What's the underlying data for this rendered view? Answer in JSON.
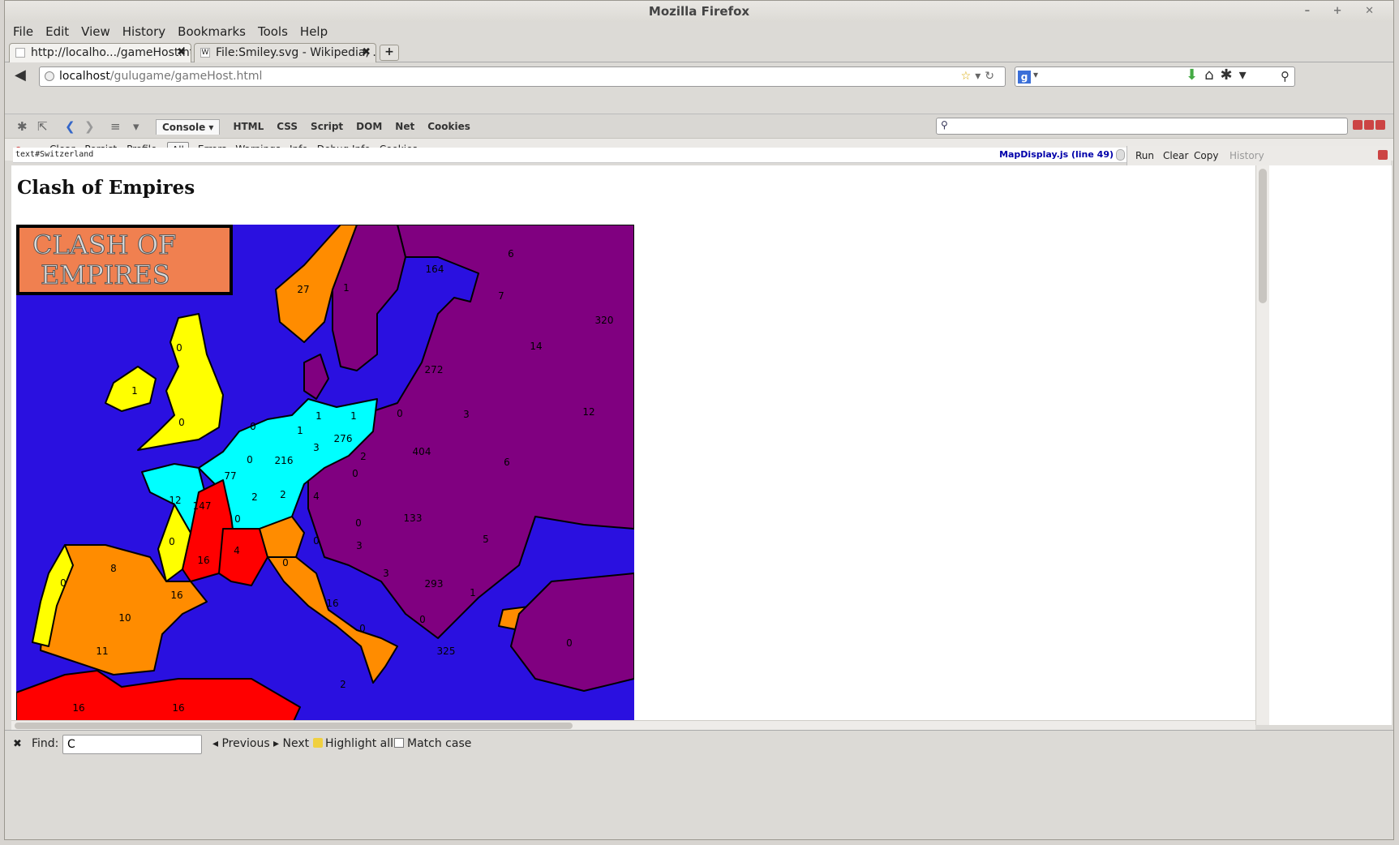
{
  "window": {
    "title": "Mozilla Firefox",
    "controls": "– + ✕"
  },
  "menu": [
    "File",
    "Edit",
    "View",
    "History",
    "Bookmarks",
    "Tools",
    "Help"
  ],
  "tabs": [
    {
      "label": "http://localho.../gameHost.html",
      "close": "✖"
    },
    {
      "label": "File:Smiley.svg - Wikipedia, ...",
      "favicon": "W",
      "close": "✖"
    }
  ],
  "new_tab": "+",
  "url": {
    "host": "localhost",
    "path": "/gulugame/gameHost.html"
  },
  "firebug": {
    "tabs": [
      "Console ▾",
      "HTML",
      "CSS",
      "Script",
      "DOM",
      "Net",
      "Cookies"
    ],
    "console_buttons": [
      "Clear",
      "Persist",
      "Profile"
    ],
    "filters": [
      "All",
      "Errors",
      "Warnings",
      "Info",
      "Debug Info",
      "Cookies"
    ],
    "log_line": "text#Switzerland",
    "log_source": "MapDisplay.js (line 49)",
    "cmd_buttons": [
      "Run",
      "Clear",
      "Copy",
      "History"
    ]
  },
  "page": {
    "heading": "Clash of Empires",
    "logo_line1": "CLASH OF",
    "logo_line2": "EMPIRES"
  },
  "map_colors": {
    "sea": "#2a10e0",
    "purple": "#800080",
    "cyan": "#00ffff",
    "yellow": "#ffff00",
    "orange": "#ff8c00",
    "red": "#ff0000"
  },
  "territories": [
    {
      "label": "27",
      "color": "orange"
    },
    {
      "label": "1",
      "color": "purple"
    },
    {
      "label": "164",
      "color": "purple"
    },
    {
      "label": "6",
      "color": "purple"
    },
    {
      "label": "7",
      "color": "purple"
    },
    {
      "label": "320",
      "color": "purple"
    },
    {
      "label": "14",
      "color": "purple"
    },
    {
      "label": "272",
      "color": "purple"
    },
    {
      "label": "3",
      "color": "purple"
    },
    {
      "label": "12",
      "color": "purple"
    },
    {
      "label": "0",
      "color": "yellow"
    },
    {
      "label": "1",
      "color": "yellow"
    },
    {
      "label": "0",
      "color": "yellow"
    },
    {
      "label": "0",
      "color": "purple"
    },
    {
      "label": "1",
      "color": "cyan"
    },
    {
      "label": "1",
      "color": "cyan"
    },
    {
      "label": "0",
      "color": "cyan"
    },
    {
      "label": "1",
      "color": "cyan"
    },
    {
      "label": "276",
      "color": "cyan"
    },
    {
      "label": "3",
      "color": "cyan"
    },
    {
      "label": "0",
      "color": "cyan"
    },
    {
      "label": "216",
      "color": "cyan"
    },
    {
      "label": "2",
      "color": "purple"
    },
    {
      "label": "404",
      "color": "purple"
    },
    {
      "label": "6",
      "color": "purple"
    },
    {
      "label": "77",
      "color": "cyan"
    },
    {
      "label": "0",
      "color": "purple"
    },
    {
      "label": "12",
      "color": "cyan"
    },
    {
      "label": "147",
      "color": "red"
    },
    {
      "label": "2",
      "color": "cyan"
    },
    {
      "label": "2",
      "color": "cyan"
    },
    {
      "label": "4",
      "color": "purple"
    },
    {
      "label": "0",
      "color": "purple"
    },
    {
      "label": "0",
      "color": "cyan"
    },
    {
      "label": "133",
      "color": "purple"
    },
    {
      "label": "5",
      "color": "purple"
    },
    {
      "label": "0",
      "color": "yellow"
    },
    {
      "label": "16",
      "color": "red"
    },
    {
      "label": "4",
      "color": "red"
    },
    {
      "label": "0",
      "color": "purple"
    },
    {
      "label": "3",
      "color": "purple"
    },
    {
      "label": "0",
      "color": "orange"
    },
    {
      "label": "8",
      "color": "orange"
    },
    {
      "label": "0",
      "color": "yellow"
    },
    {
      "label": "16",
      "color": "orange"
    },
    {
      "label": "3",
      "color": "purple"
    },
    {
      "label": "293",
      "color": "purple"
    },
    {
      "label": "1",
      "color": "purple"
    },
    {
      "label": "16",
      "color": "orange"
    },
    {
      "label": "10",
      "color": "orange"
    },
    {
      "label": "0",
      "color": "orange"
    },
    {
      "label": "0",
      "color": "purple"
    },
    {
      "label": "0",
      "color": "purple"
    },
    {
      "label": "11",
      "color": "orange"
    },
    {
      "label": "325",
      "color": "purple"
    },
    {
      "label": "2",
      "color": "purple"
    },
    {
      "label": "16",
      "color": "red"
    },
    {
      "label": "16",
      "color": "red"
    }
  ],
  "find": {
    "label": "Find:",
    "value": "C",
    "previous": "Previous",
    "next": "Next",
    "highlight": "Highlight all",
    "match_case": "Match case"
  }
}
